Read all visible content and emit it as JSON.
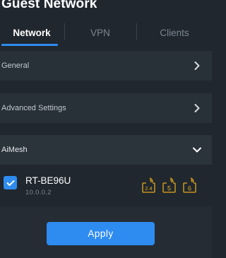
{
  "page": {
    "title": "Guest Network"
  },
  "tabs": [
    {
      "label": "Network",
      "active": true
    },
    {
      "label": "VPN",
      "active": false
    },
    {
      "label": "Clients",
      "active": false
    }
  ],
  "sections": [
    {
      "label": "General",
      "icon": "chevron-right-icon",
      "expanded": false
    },
    {
      "label": "Advanced Settings",
      "icon": "chevron-right-icon",
      "expanded": false
    },
    {
      "label": "AiMesh",
      "icon": "chevron-down-icon",
      "expanded": true
    }
  ],
  "aimesh": {
    "node": {
      "checked": true,
      "name": "RT-BE96U",
      "ip": "10.0.0.2",
      "bands": [
        "2.4",
        "5",
        "6"
      ]
    }
  },
  "actions": {
    "apply_label": "Apply"
  },
  "colors": {
    "background": "#20272e",
    "row": "#283038",
    "accent": "#2e8cf0",
    "band_icon": "#e5a91b",
    "muted_text": "#7c8690"
  }
}
